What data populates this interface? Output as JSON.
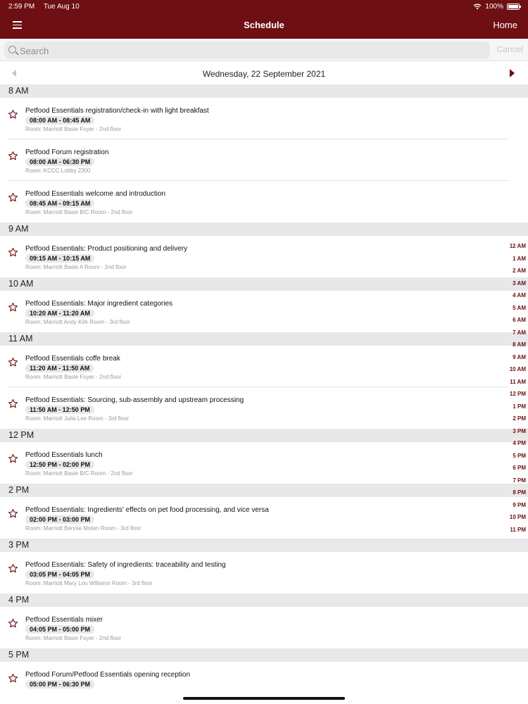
{
  "status": {
    "time": "2:59 PM",
    "date": "Tue Aug 10",
    "battery": "100%",
    "wifi_icon": "wifi-icon",
    "battery_icon": "battery-icon"
  },
  "nav": {
    "title": "Schedule",
    "home": "Home",
    "menu_icon": "hamburger-icon"
  },
  "search": {
    "placeholder": "Search",
    "cancel": "Cancel",
    "icon": "search-icon"
  },
  "date": {
    "label": "Wednesday, 22 September 2021"
  },
  "colors": {
    "brand": "#6e0f13",
    "header_bg": "#e8e8ea",
    "room_text": "#9a9a9a"
  },
  "sections": [
    {
      "hour": "8 AM",
      "events": [
        {
          "title": "Petfood Essentials registration/check-in with light breakfast",
          "time": "08:00 AM - 08:45 AM",
          "room": "Room:  Marriott Basie Foyer - 2nd floor"
        },
        {
          "title": "Petfood Forum registration",
          "time": "08:00 AM - 06:30 PM",
          "room": "Room:  KCCC Lobby 2300"
        },
        {
          "title": "Petfood Essentials welcome and introduction",
          "time": "08:45 AM - 09:15 AM",
          "room": "Room:  Marriott Basie B/C Room - 2nd floor"
        }
      ]
    },
    {
      "hour": "9 AM",
      "events": [
        {
          "title": "Petfood Essentials: Product positioning and delivery",
          "time": "09:15 AM - 10:15 AM",
          "room": "Room:  Marriott Basie A Room - 2nd floor"
        }
      ]
    },
    {
      "hour": "10 AM",
      "events": [
        {
          "title": "Petfood Essentials: Major ingredient categories",
          "time": "10:20 AM - 11:20 AM",
          "room": "Room:  Marriott Andy Kirk Room - 3rd floor"
        }
      ]
    },
    {
      "hour": "11 AM",
      "events": [
        {
          "title": "Petfood Essentials coffe break",
          "time": "11:20 AM - 11:50 AM",
          "room": "Room:  Marriott Basie Foyer - 2nd floor"
        },
        {
          "title": "Petfood Essentials: Sourcing, sub-assembly and upstream processing",
          "time": "11:50 AM - 12:50 PM",
          "room": "Room:  Marriott Julia Lee Room - 3rd floor"
        }
      ]
    },
    {
      "hour": "12 PM",
      "events": [
        {
          "title": "Petfood Essentials lunch",
          "time": "12:50 PM - 02:00 PM",
          "room": "Room:  Marriott Basie B/C Room - 2nd floor"
        }
      ]
    },
    {
      "hour": "2 PM",
      "events": [
        {
          "title": "Petfood Essentials: Ingredients' effects on pet food processing, and vice versa",
          "time": "02:00 PM - 03:00 PM",
          "room": "Room:  Marriott Bennie Moten Room - 3rd floor"
        }
      ]
    },
    {
      "hour": "3 PM",
      "events": [
        {
          "title": "Petfood Essentials: Safety of ingredients: traceability and testing",
          "time": "03:05 PM - 04:05 PM",
          "room": "Room:  Marriott Mary Lou Williams Room - 3rd floor"
        }
      ]
    },
    {
      "hour": "4 PM",
      "events": [
        {
          "title": "Petfood Essentials mixer",
          "time": "04:05 PM - 05:00 PM",
          "room": "Room:  Marriott Basie Foyer - 2nd floor"
        }
      ]
    },
    {
      "hour": "5 PM",
      "events": [
        {
          "title": "Petfood Forum/Petfood Essentials opening reception",
          "time": "05:00 PM - 06:30 PM",
          "room": ""
        }
      ]
    }
  ],
  "hour_index": [
    "12 AM",
    "1 AM",
    "2 AM",
    "3 AM",
    "4 AM",
    "5 AM",
    "6 AM",
    "7 AM",
    "8 AM",
    "9 AM",
    "10 AM",
    "11 AM",
    "12 PM",
    "1 PM",
    "2 PM",
    "3 PM",
    "4 PM",
    "5 PM",
    "6 PM",
    "7 PM",
    "8 PM",
    "9 PM",
    "10 PM",
    "11 PM"
  ]
}
